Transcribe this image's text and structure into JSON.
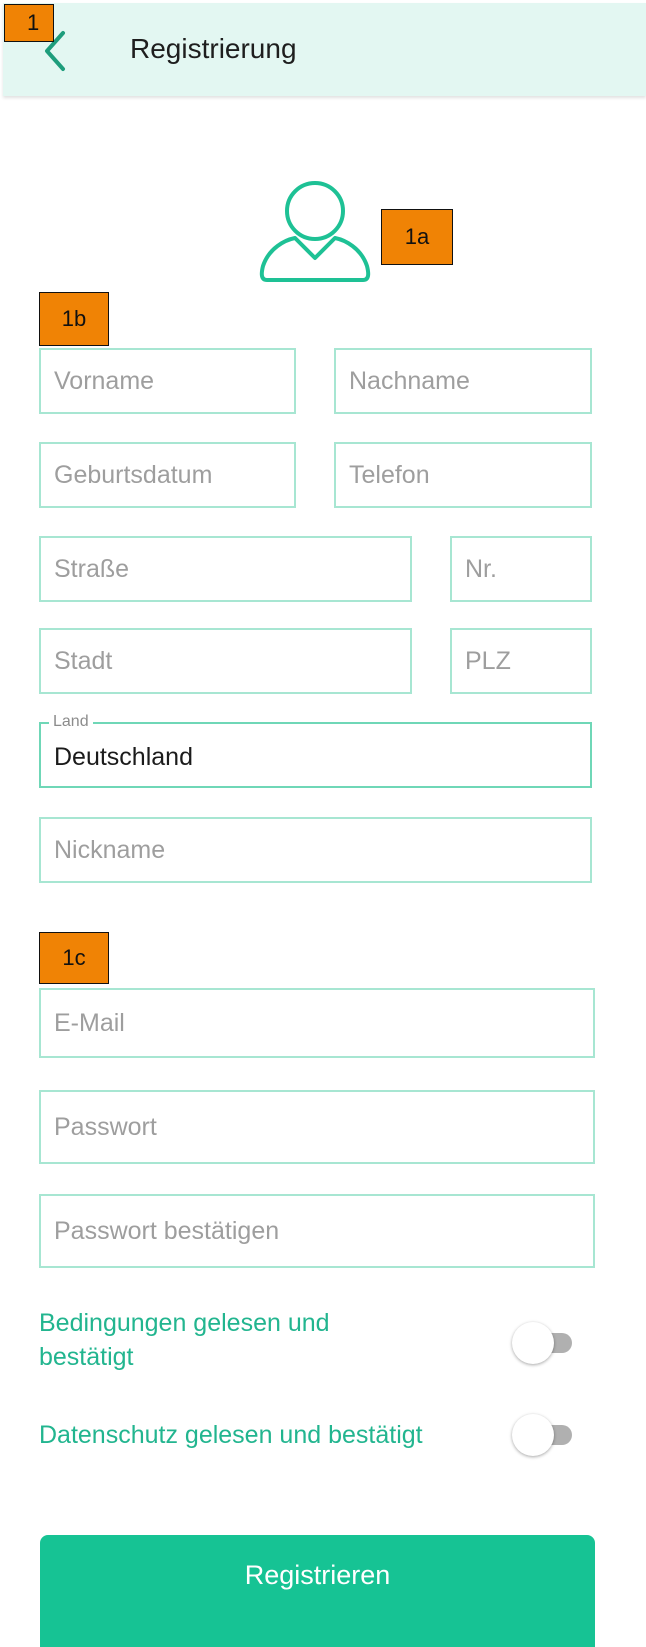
{
  "header": {
    "title": "Registrierung",
    "back_icon": "back-arrow-icon"
  },
  "avatar": {
    "icon": "user-profile-icon",
    "color": "#1ec195"
  },
  "annotations": {
    "a1": "1",
    "a1a": "1a",
    "a1b": "1b",
    "a1c": "1c"
  },
  "form": {
    "vorname": {
      "placeholder": "Vorname"
    },
    "nachname": {
      "placeholder": "Nachname"
    },
    "geburtsdatum": {
      "placeholder": "Geburtsdatum"
    },
    "telefon": {
      "placeholder": "Telefon"
    },
    "strasse": {
      "placeholder": "Straße"
    },
    "nr": {
      "placeholder": "Nr."
    },
    "stadt": {
      "placeholder": "Stadt"
    },
    "plz": {
      "placeholder": "PLZ"
    },
    "land": {
      "label": "Land",
      "value": "Deutschland"
    },
    "nickname": {
      "placeholder": "Nickname"
    },
    "email": {
      "placeholder": "E-Mail"
    },
    "passwort": {
      "placeholder": "Passwort"
    },
    "passwort_bestaetigen": {
      "placeholder": "Passwort bestätigen"
    }
  },
  "toggles": {
    "bedingungen": {
      "label_line1": "Bedingungen gelesen und",
      "label_line2": "bestätigt",
      "checked": false
    },
    "datenschutz": {
      "label": "Datenschutz gelesen und bestätigt",
      "checked": false
    }
  },
  "submit": {
    "label": "Registrieren"
  },
  "colors": {
    "accent": "#16c394",
    "field_border": "#a7e6d2",
    "appbar_bg": "#e3f7f2"
  }
}
